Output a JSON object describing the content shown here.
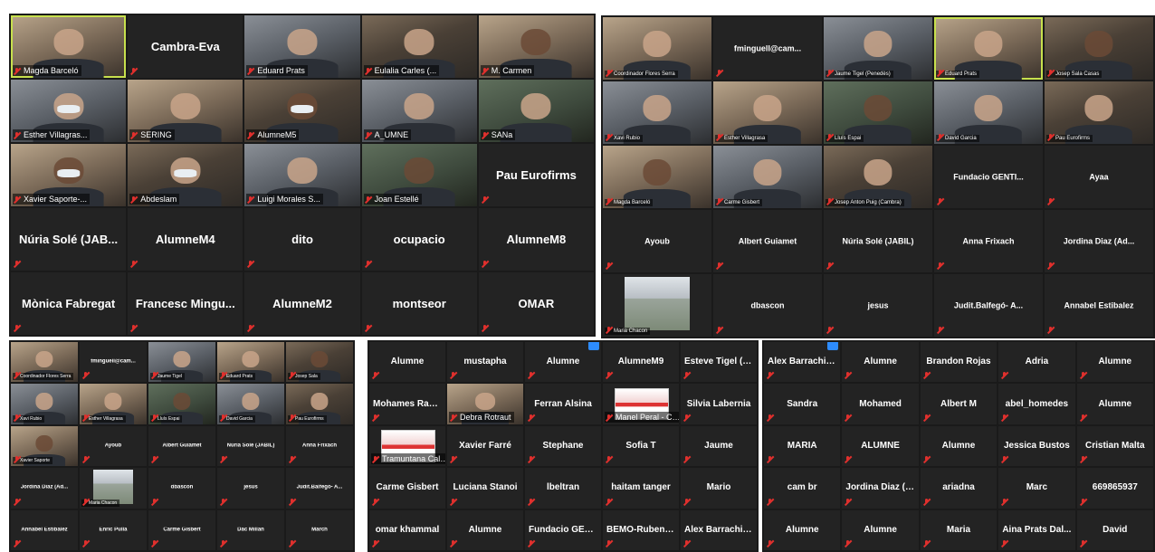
{
  "panel1": {
    "tiles": [
      {
        "kind": "video",
        "name": "Magda Barceló",
        "speaker": true,
        "style": "v3"
      },
      {
        "kind": "name",
        "name": "Cambra-Eva"
      },
      {
        "kind": "video",
        "name": "Eduard Prats",
        "style": "v2"
      },
      {
        "kind": "video",
        "name": "Eulalia Carles (...",
        "style": "v1"
      },
      {
        "kind": "video",
        "name": "M. Carmen",
        "style": "v3"
      },
      {
        "kind": "video",
        "name": "Esther Villagras...",
        "style": "v2",
        "mask": true
      },
      {
        "kind": "video",
        "name": "SERING",
        "style": "v3"
      },
      {
        "kind": "video",
        "name": "AlumneM5",
        "style": "v1",
        "mask": true
      },
      {
        "kind": "video",
        "name": "A_UMNE",
        "style": "v2"
      },
      {
        "kind": "video",
        "name": "SANa",
        "style": "v4"
      },
      {
        "kind": "video",
        "name": "Xavier Saporte-...",
        "style": "v3",
        "mask": true
      },
      {
        "kind": "video",
        "name": "Abdeslam",
        "style": "v1",
        "mask": true
      },
      {
        "kind": "video",
        "name": "Luigi Morales S...",
        "style": "v2"
      },
      {
        "kind": "video",
        "name": "Joan Estellé",
        "style": "v4"
      },
      {
        "kind": "name",
        "name": "Pau Eurofirms"
      },
      {
        "kind": "name",
        "name": "Núria Solé (JAB..."
      },
      {
        "kind": "name",
        "name": "AlumneM4"
      },
      {
        "kind": "name",
        "name": "dito"
      },
      {
        "kind": "name",
        "name": "ocupacio"
      },
      {
        "kind": "name",
        "name": "AlumneM8"
      },
      {
        "kind": "name",
        "name": "Mònica Fabregat"
      },
      {
        "kind": "name",
        "name": "Francesc Mingu..."
      },
      {
        "kind": "name",
        "name": "AlumneM2"
      },
      {
        "kind": "name",
        "name": "montseor"
      },
      {
        "kind": "name",
        "name": "OMAR"
      }
    ]
  },
  "panel2": {
    "tiles": [
      {
        "kind": "video",
        "name": "Coordinador Flores Serra",
        "style": "v3"
      },
      {
        "kind": "name",
        "name": "fminguell@cam..."
      },
      {
        "kind": "video",
        "name": "Jaume Tigel (Penedès)",
        "style": "v2"
      },
      {
        "kind": "video",
        "name": "Eduard Prats",
        "speaker": true,
        "style": "v3"
      },
      {
        "kind": "video",
        "name": "Josep Sala Casas",
        "style": "v1"
      },
      {
        "kind": "video",
        "name": "Xavi Rubio",
        "style": "v2"
      },
      {
        "kind": "video",
        "name": "Esther Villagrasa",
        "style": "v3"
      },
      {
        "kind": "video",
        "name": "Lluís Espai",
        "style": "v4"
      },
      {
        "kind": "video",
        "name": "David Garcia",
        "style": "v2"
      },
      {
        "kind": "video",
        "name": "Pau Eurofirms",
        "style": "v1"
      },
      {
        "kind": "video",
        "name": "Magda Barceló",
        "style": "v3"
      },
      {
        "kind": "video",
        "name": "Carme Gisbert",
        "style": "v2"
      },
      {
        "kind": "video",
        "name": "Josep Anton Puig (Cambra)",
        "style": "v1"
      },
      {
        "kind": "name",
        "name": "Fundacio GENTI..."
      },
      {
        "kind": "name",
        "name": "Ayaa"
      },
      {
        "kind": "name",
        "name": "Ayoub"
      },
      {
        "kind": "name",
        "name": "Albert Guiamet"
      },
      {
        "kind": "name",
        "name": "Núria Solé (JABIL)"
      },
      {
        "kind": "name",
        "name": "Anna Frixach"
      },
      {
        "kind": "name",
        "name": "Jordina Diaz (Ad..."
      },
      {
        "kind": "field",
        "name": "Maria Chacon"
      },
      {
        "kind": "name",
        "name": "dbascon"
      },
      {
        "kind": "name",
        "name": "jesus"
      },
      {
        "kind": "name",
        "name": "Judit.Balfegó- A..."
      },
      {
        "kind": "name",
        "name": "Annabel Estibalez"
      }
    ]
  },
  "panel3": {
    "tiles": [
      {
        "kind": "video",
        "name": "Coordinador Flores Serra",
        "style": "v3"
      },
      {
        "kind": "name",
        "name": "fminguell@cam..."
      },
      {
        "kind": "video",
        "name": "Jaume Tigel",
        "style": "v2"
      },
      {
        "kind": "video",
        "name": "Eduard Prats",
        "style": "v3"
      },
      {
        "kind": "video",
        "name": "Josep Sala",
        "style": "v1"
      },
      {
        "kind": "video",
        "name": "Xavi Rubio",
        "style": "v2"
      },
      {
        "kind": "video",
        "name": "Esther Villagrasa",
        "style": "v3"
      },
      {
        "kind": "video",
        "name": "Lluís Espai",
        "style": "v4"
      },
      {
        "kind": "video",
        "name": "David Garcia",
        "style": "v2"
      },
      {
        "kind": "video",
        "name": "Pau Eurofirms",
        "style": "v1"
      },
      {
        "kind": "video",
        "name": "Xavier Saporte",
        "style": "v3"
      },
      {
        "kind": "name",
        "name": "Ayoub"
      },
      {
        "kind": "name",
        "name": "Albert Guiamet"
      },
      {
        "kind": "name",
        "name": "Núria Solé (JABIL)"
      },
      {
        "kind": "name",
        "name": "Anna Frixach"
      },
      {
        "kind": "name",
        "name": "Jordina Diaz (Ad..."
      },
      {
        "kind": "field",
        "name": "Maria Chacon"
      },
      {
        "kind": "name",
        "name": "dbascon"
      },
      {
        "kind": "name",
        "name": "jesus"
      },
      {
        "kind": "name",
        "name": "Judit.Balfegó- A..."
      },
      {
        "kind": "name",
        "name": "Annabel Estibalez"
      },
      {
        "kind": "name",
        "name": "Enric Pulla"
      },
      {
        "kind": "name",
        "name": "Carme Gisbert"
      },
      {
        "kind": "name",
        "name": "Dac Millan"
      },
      {
        "kind": "name",
        "name": "March"
      }
    ]
  },
  "panel4": {
    "tiles": [
      {
        "kind": "name",
        "name": "Alumne"
      },
      {
        "kind": "name",
        "name": "mustapha"
      },
      {
        "kind": "name",
        "name": "Alumne",
        "badge": true
      },
      {
        "kind": "name",
        "name": "AlumneM9"
      },
      {
        "kind": "name",
        "name": "Esteve Tigel (Pe..."
      },
      {
        "kind": "name",
        "name": "Mohames Rah..."
      },
      {
        "kind": "video",
        "name": "Debra Rotraut",
        "style": "v3"
      },
      {
        "kind": "name",
        "name": "Ferran Alsina"
      },
      {
        "kind": "doc",
        "name": "Manel Peral - Cu..."
      },
      {
        "kind": "name",
        "name": "Silvia Labernia"
      },
      {
        "kind": "doc",
        "name": "Tramuntana Calceros"
      },
      {
        "kind": "name",
        "name": "Xavier Farré"
      },
      {
        "kind": "name",
        "name": "Stephane"
      },
      {
        "kind": "name",
        "name": "Sofia T"
      },
      {
        "kind": "name",
        "name": "Jaume"
      },
      {
        "kind": "name",
        "name": "Carme Gisbert"
      },
      {
        "kind": "name",
        "name": "Luciana Stanoi"
      },
      {
        "kind": "name",
        "name": "lbeltran"
      },
      {
        "kind": "name",
        "name": "haitam tanger"
      },
      {
        "kind": "name",
        "name": "Mario"
      },
      {
        "kind": "name",
        "name": "omar khammal"
      },
      {
        "kind": "name",
        "name": "Alumne"
      },
      {
        "kind": "name",
        "name": "Fundacio GENTI..."
      },
      {
        "kind": "name",
        "name": "BEMO-Ruben A..."
      },
      {
        "kind": "name",
        "name": "Alex Barrachina..."
      }
    ]
  },
  "panel5": {
    "tiles": [
      {
        "kind": "name",
        "name": "Alex Barrachina...",
        "badge": true
      },
      {
        "kind": "name",
        "name": "Alumne"
      },
      {
        "kind": "name",
        "name": "Brandon Rojas"
      },
      {
        "kind": "name",
        "name": "Adria"
      },
      {
        "kind": "name",
        "name": "Alumne"
      },
      {
        "kind": "name",
        "name": "Sandra"
      },
      {
        "kind": "name",
        "name": "Mohamed"
      },
      {
        "kind": "name",
        "name": "Albert M"
      },
      {
        "kind": "name",
        "name": "abel_homedes"
      },
      {
        "kind": "name",
        "name": "Alumne"
      },
      {
        "kind": "name",
        "name": "MARIA"
      },
      {
        "kind": "name",
        "name": "ALUMNE"
      },
      {
        "kind": "name",
        "name": "Alumne"
      },
      {
        "kind": "name",
        "name": "Jessica Bustos"
      },
      {
        "kind": "name",
        "name": "Cristian Malta"
      },
      {
        "kind": "name",
        "name": "cam br"
      },
      {
        "kind": "name",
        "name": "Jordina Diaz (A..."
      },
      {
        "kind": "name",
        "name": "ariadna"
      },
      {
        "kind": "name",
        "name": "Marc"
      },
      {
        "kind": "name",
        "name": "669865937"
      },
      {
        "kind": "name",
        "name": "Alumne"
      },
      {
        "kind": "name",
        "name": "Alumne"
      },
      {
        "kind": "name",
        "name": "Maria"
      },
      {
        "kind": "name",
        "name": "Aina Prats Dal..."
      },
      {
        "kind": "name",
        "name": "David"
      }
    ]
  },
  "colors": {
    "active_speaker": "#c7e04d",
    "muted": "#e0302d",
    "badge": "#2d8cff",
    "tile_bg": "#232323"
  }
}
